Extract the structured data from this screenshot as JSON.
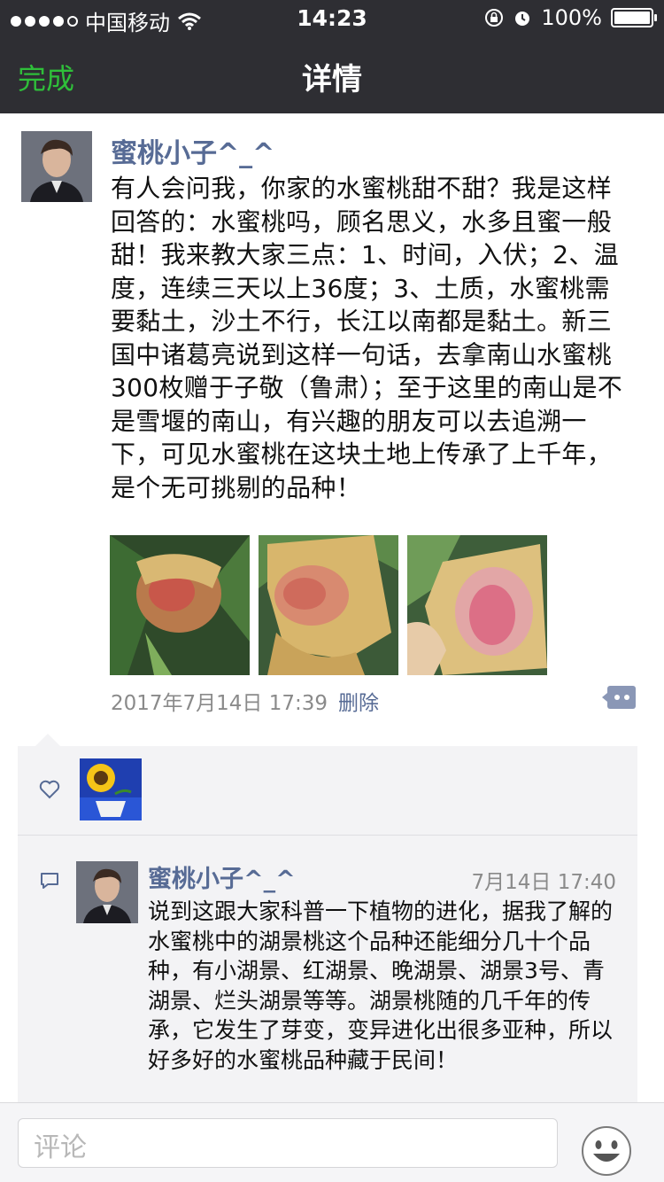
{
  "status_bar": {
    "carrier": "中国移动",
    "time": "14:23",
    "battery": "100%",
    "signal_bars_filled": 4,
    "signal_bars_total": 5
  },
  "nav": {
    "back_label": "完成",
    "title": "详情"
  },
  "post": {
    "author": "蜜桃小子^_^",
    "text": "有人会问我，你家的水蜜桃甜不甜？我是这样回答的：水蜜桃吗，顾名思义，水多且蜜一般甜！我来教大家三点：1、时间，入伏；2、温度，连续三天以上36度；3、土质，水蜜桃需要黏土，沙土不行，长江以南都是黏土。新三国中诸葛亮说到这样一句话，去拿南山水蜜桃300枚赠于子敬（鲁肃）；至于这里的南山是不是雪堰的南山，有兴趣的朋友可以去追溯一下，可见水蜜桃在这块土地上传承了上千年，是个无可挑剔的品种！",
    "timestamp": "2017年7月14日 17:39",
    "delete_label": "删除",
    "photo_count": 3
  },
  "comment": {
    "author": "蜜桃小子^_^",
    "time": "7月14日 17:40",
    "text": "说到这跟大家科普一下植物的进化，据我了解的水蜜桃中的湖景桃这个品种还能细分几十个品种，有小湖景、红湖景、晚湖景、湖景3号、青湖景、烂头湖景等等。湖景桃随的几千年的传承，它发生了芽变，变异进化出很多亚种，所以好多好的水蜜桃品种藏于民间！"
  },
  "input": {
    "placeholder": "评论"
  },
  "colors": {
    "nav_background": "#2e2e33",
    "accent_green": "#2fbf3a",
    "link_blue": "#576b95",
    "panel_background": "#f3f3f5"
  },
  "icons": [
    "wifi-icon",
    "orientation-lock-icon",
    "alarm-icon",
    "battery-icon",
    "more-options-icon",
    "heart-icon",
    "comment-icon",
    "emoji-icon"
  ]
}
